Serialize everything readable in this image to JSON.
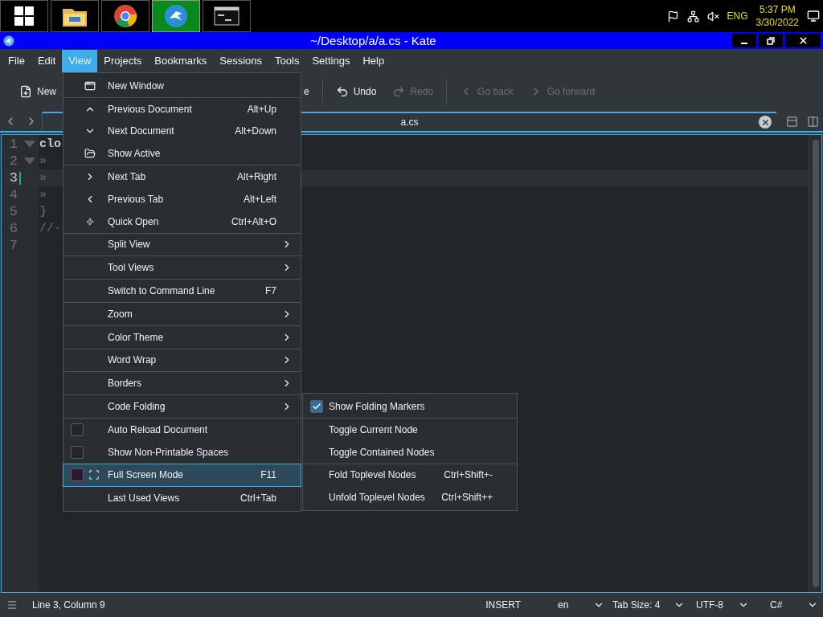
{
  "taskbar": {
    "apps": [
      {
        "kind": "start",
        "selected": false
      },
      {
        "kind": "explorer",
        "selected": false
      },
      {
        "kind": "browser",
        "selected": false
      },
      {
        "kind": "editor",
        "selected": true
      },
      {
        "kind": "terminal",
        "selected": false
      }
    ],
    "language": "ENG",
    "time": "5:37 PM",
    "date": "3/30/2022"
  },
  "window": {
    "title": "~/Desktop/a/a.cs  - Kate"
  },
  "menubar": [
    {
      "label": "File",
      "selected": false
    },
    {
      "label": "Edit",
      "selected": false
    },
    {
      "label": "View",
      "selected": true
    },
    {
      "label": "Projects",
      "selected": false
    },
    {
      "label": "Bookmarks",
      "selected": false
    },
    {
      "label": "Sessions",
      "selected": false
    },
    {
      "label": "Tools",
      "selected": false
    },
    {
      "label": "Settings",
      "selected": false
    },
    {
      "label": "Help",
      "selected": false
    }
  ],
  "toolbar": [
    {
      "label": "New",
      "disabled": false
    },
    {
      "label": "e",
      "disabled": false
    },
    {
      "label": "Undo",
      "disabled": false
    },
    {
      "label": "Redo",
      "disabled": true
    },
    {
      "label": "Go back",
      "disabled": true
    },
    {
      "label": "Go forward",
      "disabled": true
    }
  ],
  "tabs": [
    {
      "label": "a.cs",
      "selected": true
    }
  ],
  "editor": {
    "lines": [
      {
        "number": "1",
        "text": "clo",
        "foldable": true,
        "current": false
      },
      {
        "number": "2",
        "text": "»",
        "foldable": true,
        "current": false
      },
      {
        "number": "3",
        "text": "»",
        "foldable": false,
        "current": true
      },
      {
        "number": "4",
        "text": "»",
        "foldable": false,
        "current": false
      },
      {
        "number": "5",
        "text": "}",
        "foldable": false,
        "current": false
      },
      {
        "number": "6",
        "text": "//·",
        "foldable": false,
        "current": false
      },
      {
        "number": "7",
        "foldable": false,
        "current": false
      }
    ]
  },
  "view_menu": {
    "sections": [
      [
        {
          "kind": "action",
          "label": "New Window",
          "selected": false
        }
      ],
      [
        {
          "kind": "action",
          "label": "Previous Document",
          "shortcut": "Alt+Up",
          "selected": false
        },
        {
          "kind": "action",
          "label": "Next Document",
          "shortcut": "Alt+Down",
          "selected": false
        },
        {
          "kind": "action",
          "label": "Show Active",
          "selected": false
        }
      ],
      [
        {
          "kind": "action",
          "label": "Next Tab",
          "shortcut": "Alt+Right",
          "selected": false
        },
        {
          "kind": "action",
          "label": "Previous Tab",
          "shortcut": "Alt+Left",
          "selected": false
        },
        {
          "kind": "action",
          "label": "Quick Open",
          "shortcut": "Ctrl+Alt+O",
          "selected": false
        }
      ],
      [
        {
          "kind": "submenu",
          "label": "Split View",
          "selected": false
        }
      ],
      [
        {
          "kind": "submenu",
          "label": "Tool Views",
          "selected": false
        }
      ],
      [
        {
          "kind": "action",
          "label": "Switch to Command Line",
          "shortcut": "F7",
          "selected": false
        }
      ],
      [
        {
          "kind": "submenu",
          "label": "Zoom",
          "selected": false
        }
      ],
      [
        {
          "kind": "submenu",
          "label": "Color Theme",
          "selected": false
        }
      ],
      [
        {
          "kind": "submenu",
          "label": "Word Wrap",
          "selected": false
        }
      ],
      [
        {
          "kind": "submenu",
          "label": "Borders",
          "selected": false
        }
      ],
      [
        {
          "kind": "submenu",
          "label": "Code Folding",
          "selected": false,
          "expanded": true,
          "submenu": {
            "sections": [
              [
                {
                  "kind": "checkbox",
                  "label": "Show Folding Markers",
                  "checked": true
                }
              ],
              [
                {
                  "kind": "action",
                  "label": "Toggle Current Node"
                },
                {
                  "kind": "action",
                  "label": "Toggle Contained Nodes"
                }
              ],
              [
                {
                  "kind": "action",
                  "label": "Fold Toplevel Nodes",
                  "shortcut": "Ctrl+Shift+-"
                },
                {
                  "kind": "action",
                  "label": "Unfold Toplevel Nodes",
                  "shortcut": "Ctrl+Shift++"
                }
              ]
            ]
          }
        }
      ],
      [
        {
          "kind": "checkbox",
          "label": "Auto Reload Document",
          "checked": false,
          "selected": false
        },
        {
          "kind": "checkbox",
          "label": "Show Non-Printable Spaces",
          "checked": false,
          "selected": false
        }
      ],
      [
        {
          "kind": "checkbox",
          "label": "Full Screen Mode",
          "checked": false,
          "shortcut": "F11",
          "selected": true
        }
      ],
      [
        {
          "kind": "action",
          "label": "Last Used Views",
          "shortcut": "Ctrl+Tab",
          "selected": false
        }
      ]
    ]
  },
  "status_bar": {
    "position": "Line 3, Column 9",
    "mode": "INSERT",
    "language": "en",
    "tab_size": "Tab Size: 4",
    "encoding": "UTF-8",
    "syntax": "C#"
  }
}
